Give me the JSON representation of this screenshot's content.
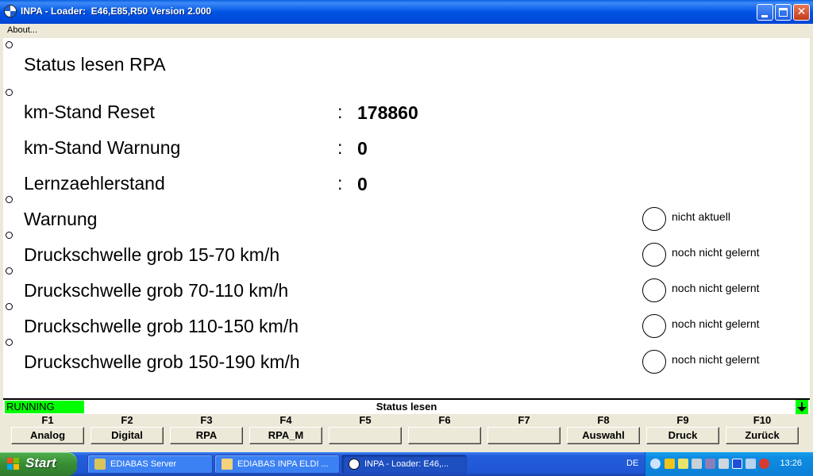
{
  "window": {
    "title": "INPA - Loader:  E46,E85,R50 Version 2.000"
  },
  "menu": {
    "about": "About..."
  },
  "main": {
    "heading": "Status lesen RPA",
    "values": [
      {
        "label": "km-Stand Reset",
        "colon": ":",
        "value": "178860"
      },
      {
        "label": "km-Stand Warnung",
        "colon": ":",
        "value": "0"
      },
      {
        "label": "Lernzaehlerstand",
        "colon": ":",
        "value": "0"
      }
    ],
    "indicators": [
      {
        "label": "Warnung",
        "state": "nicht aktuell"
      },
      {
        "label": "Druckschwelle grob 15-70 km/h",
        "state": "noch nicht gelernt"
      },
      {
        "label": "Druckschwelle grob 70-110 km/h",
        "state": "noch nicht gelernt"
      },
      {
        "label": "Druckschwelle grob 110-150 km/h",
        "state": "noch nicht gelernt"
      },
      {
        "label": "Druckschwelle grob 150-190 km/h",
        "state": "noch nicht gelernt"
      }
    ]
  },
  "statusbar": {
    "state": "RUNNING",
    "center": "Status lesen",
    "state_color": "#00ff00"
  },
  "fkeys": [
    {
      "key": "F1",
      "label": "Analog"
    },
    {
      "key": "F2",
      "label": "Digital"
    },
    {
      "key": "F3",
      "label": "RPA"
    },
    {
      "key": "F4",
      "label": "RPA_M"
    },
    {
      "key": "F5",
      "label": ""
    },
    {
      "key": "F6",
      "label": ""
    },
    {
      "key": "F7",
      "label": ""
    },
    {
      "key": "F8",
      "label": "Auswahl"
    },
    {
      "key": "F9",
      "label": "Druck"
    },
    {
      "key": "F10",
      "label": "Zurück"
    }
  ],
  "taskbar": {
    "start": "Start",
    "tasks": [
      {
        "label": "EDIABAS Server",
        "icon": "server-icon"
      },
      {
        "label": "EDIABAS INPA ELDI ...",
        "icon": "folder-icon"
      },
      {
        "label": "INPA - Loader:  E46,...",
        "icon": "bmw-icon"
      }
    ],
    "language": "DE",
    "clock": "13:26"
  }
}
